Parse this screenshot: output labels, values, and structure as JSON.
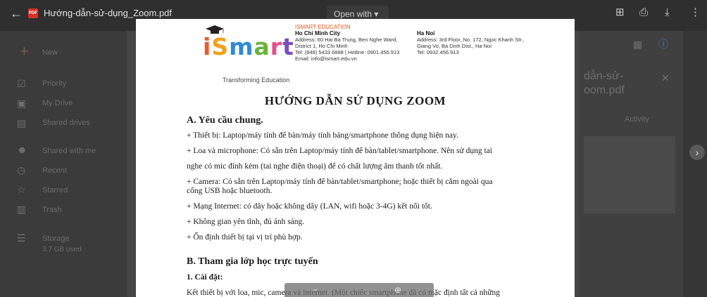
{
  "viewer": {
    "file_name": "Hướng-dẫn-sử-dụng_Zoom.pdf",
    "open_with": "Open with ▾",
    "back_icon": "arrow-back-icon"
  },
  "background": {
    "sidebar": {
      "new_label": "New",
      "items": [
        "Priority",
        "My Drive",
        "Shared drives",
        "Shared with me",
        "Recent",
        "Starred",
        "Trash",
        "Storage"
      ],
      "storage_used": "3.7 GB used"
    },
    "details_panel": {
      "file_title_line1": "dẫn-sử-",
      "file_title_line2": "oom.pdf",
      "activity_tab": "Activity"
    }
  },
  "pdf": {
    "org_name": "ISMART EDUCATION",
    "hcm": {
      "city": "Ho Chi Minh City",
      "line1": "Address: 60 Hai Ba Trung, Ben Nghe Ward,",
      "line2": "District 1, Ho Chi Minh",
      "line3": "Tel: (848) 5433 6888 | Hotline: 0901.456.913",
      "line4": "Email: info@ismart.edu.vn"
    },
    "hn": {
      "city": "Ha Noi",
      "line1": "Address: 3rd Floor, No. 172, Ngoc Khanh Str.,",
      "line2": "Giang Vo, Ba Dinh Dist., Ha Noi",
      "line3": "Tel: 0932.456.913"
    },
    "logo_tagline": "Transforming Education",
    "title": "HƯỚNG DẪN SỬ DỤNG ZOOM",
    "section_a": "A. Yêu cầu chung.",
    "para1": "+ Thiết bị: Laptop/máy tính để bàn/máy tính bảng/smartphone thông dụng hiện nay.",
    "para2a": "+ Loa và microphone: Có sẵn trên Laptop/máy tính để bàn/tablet/smartphone. Nên sử dụng tai",
    "para2b": "nghe có mic đính kèm (tai nghe điện thoại) để có chất lượng âm thanh tốt nhất.",
    "para3a": "+ Camera: Có sẵn trên Laptop/máy tính để bàn/tablet/smartphone; hoặc thiết bị cắm ngoài qua",
    "para3b": "cổng USB hoặc bluetooth.",
    "para4": "+ Mạng Internet: có dây hoặc không dây (LAN, wifi hoặc 3-4G) kết nối tốt.",
    "para5": "+ Không gian yên tĩnh, đủ ánh sáng.",
    "para6": "+ Ổn định thiết bị tại vị trí phù hợp.",
    "section_b": "B. Tham gia lớp học trực tuyến",
    "sub_b1": "1. Cài đặt:",
    "para7": "Kết thiết bị với loa, mic, camera và internet. (Một chiếc smartphone đã có mặc định tất cả những"
  }
}
